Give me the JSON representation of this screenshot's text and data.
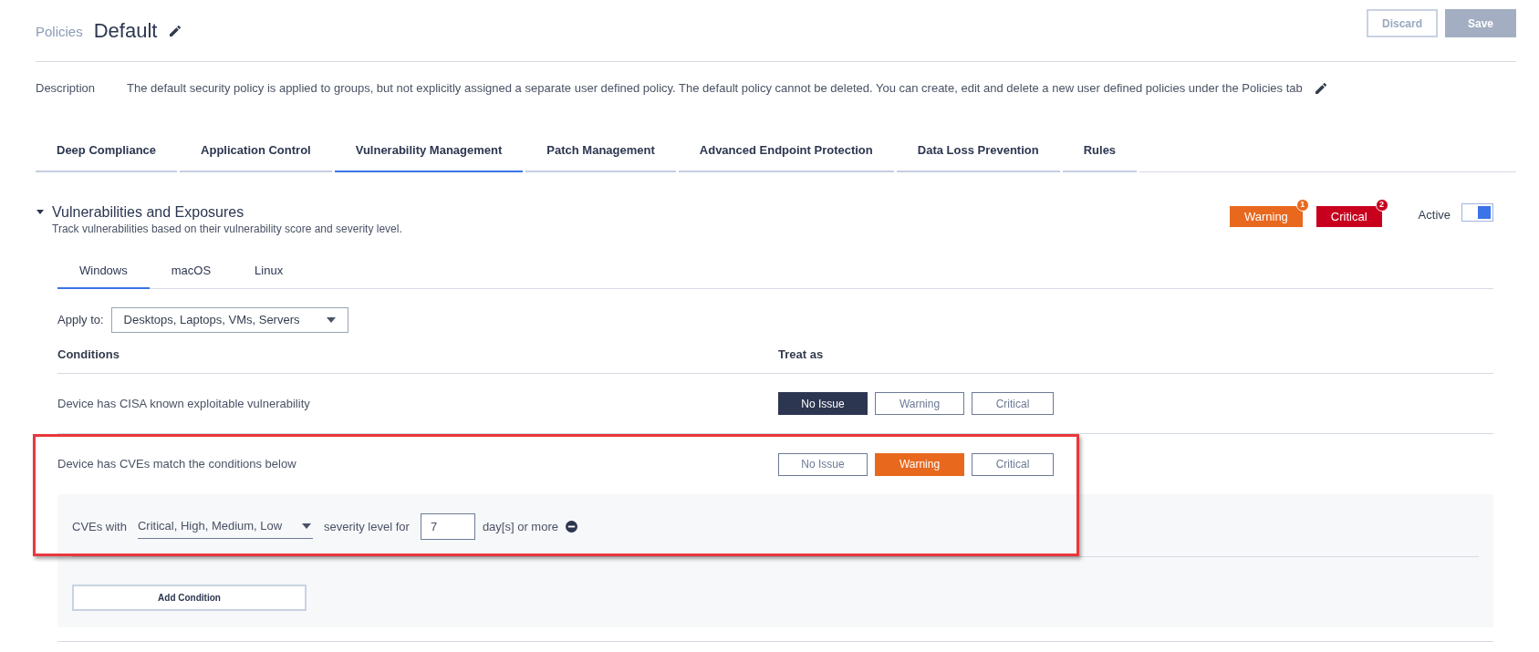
{
  "breadcrumb": "Policies",
  "title": "Default",
  "actions": [
    {
      "label": "Discard",
      "kind": "outline",
      "disabled": true
    },
    {
      "label": "Save",
      "kind": "filled",
      "disabled": true
    }
  ],
  "description": {
    "label": "Description",
    "text": "The default security policy is applied to groups, but not explicitly assigned a separate user defined policy. The default policy cannot be deleted. You can create, edit and delete a new user defined policies under the Policies tab"
  },
  "tabs": [
    {
      "label": "Deep Compliance",
      "selected": false
    },
    {
      "label": "Application Control",
      "selected": false
    },
    {
      "label": "Vulnerability Management",
      "selected": true
    },
    {
      "label": "Patch Management",
      "selected": false
    },
    {
      "label": "Advanced Endpoint Protection",
      "selected": false
    },
    {
      "label": "Data Loss Prevention",
      "selected": false
    },
    {
      "label": "Rules",
      "selected": false
    }
  ],
  "section": {
    "title": "Vulnerabilities and Exposures",
    "subtitle": "Track vulnerabilities based on their vulnerability score and severity level.",
    "expanded": true,
    "badges": [
      {
        "label": "Warning",
        "count": "1",
        "color": "#e8681e"
      },
      {
        "label": "Critical",
        "count": "2",
        "color": "#c8001e"
      }
    ],
    "active": {
      "label": "Active",
      "on": true
    },
    "os_tabs": [
      {
        "label": "Windows",
        "selected": true
      },
      {
        "label": "macOS",
        "selected": false
      },
      {
        "label": "Linux",
        "selected": false
      }
    ],
    "apply_to": {
      "label": "Apply to:",
      "value": "Desktops, Laptops, VMs, Servers"
    },
    "columns": [
      "Conditions",
      "Treat as"
    ],
    "conditions": [
      {
        "text": "Device has CISA known exploitable vulnerability",
        "highlighted": false,
        "treat_as": [
          {
            "label": "No Issue",
            "kind": "none",
            "selected": true
          },
          {
            "label": "Warning",
            "kind": "warning",
            "selected": false
          },
          {
            "label": "Critical",
            "kind": "critical",
            "selected": false
          }
        ]
      },
      {
        "text": "Device has CVEs match the conditions below",
        "highlighted": true,
        "treat_as": [
          {
            "label": "No Issue",
            "kind": "none",
            "selected": false
          },
          {
            "label": "Warning",
            "kind": "warning",
            "selected": true
          },
          {
            "label": "Critical",
            "kind": "critical",
            "selected": false
          }
        ],
        "criteria": [
          {
            "prefix": "CVEs with",
            "severity": "Critical, High, Medium, Low",
            "middle": "severity level for",
            "days": "7",
            "suffix": "day[s] or more"
          }
        ],
        "add_button": "Add Condition"
      }
    ]
  }
}
